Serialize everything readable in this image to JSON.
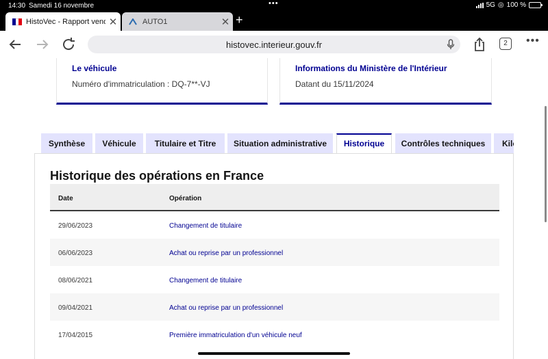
{
  "status_bar": {
    "time": "14:30",
    "date": "Samedi 16 novembre",
    "network": "5G",
    "battery": "100 %"
  },
  "browser": {
    "tabs": [
      {
        "title": "HistoVec - Rapport vendeur",
        "active": true
      },
      {
        "title": "AUTO1",
        "active": false
      }
    ],
    "url": "histovec.interieur.gouv.fr",
    "tab_count": "2"
  },
  "cards": [
    {
      "title": "Le véhicule",
      "text": "Numéro d'immatriculation : DQ-7**-VJ"
    },
    {
      "title": "Informations du Ministère de l'Intérieur",
      "text": "Datant du 15/11/2024"
    }
  ],
  "page_tabs": [
    "Synthèse",
    "Véhicule",
    "Titulaire et Titre",
    "Situation administrative",
    "Historique",
    "Contrôles techniques",
    "Kilométrage"
  ],
  "active_tab": "Historique",
  "history": {
    "title": "Historique des opérations en France",
    "columns": {
      "date": "Date",
      "operation": "Opération"
    },
    "rows": [
      {
        "date": "29/06/2023",
        "operation": "Changement de titulaire"
      },
      {
        "date": "06/06/2023",
        "operation": "Achat ou reprise par un professionnel"
      },
      {
        "date": "08/06/2021",
        "operation": "Changement de titulaire"
      },
      {
        "date": "09/04/2021",
        "operation": "Achat ou reprise par un professionnel"
      },
      {
        "date": "17/04/2015",
        "operation": "Première immatriculation d'un véhicule neuf"
      }
    ]
  },
  "colors": {
    "brand_blue": "#000091",
    "tab_bg": "#e3e3fd",
    "row_alt": "#f6f6f6"
  }
}
